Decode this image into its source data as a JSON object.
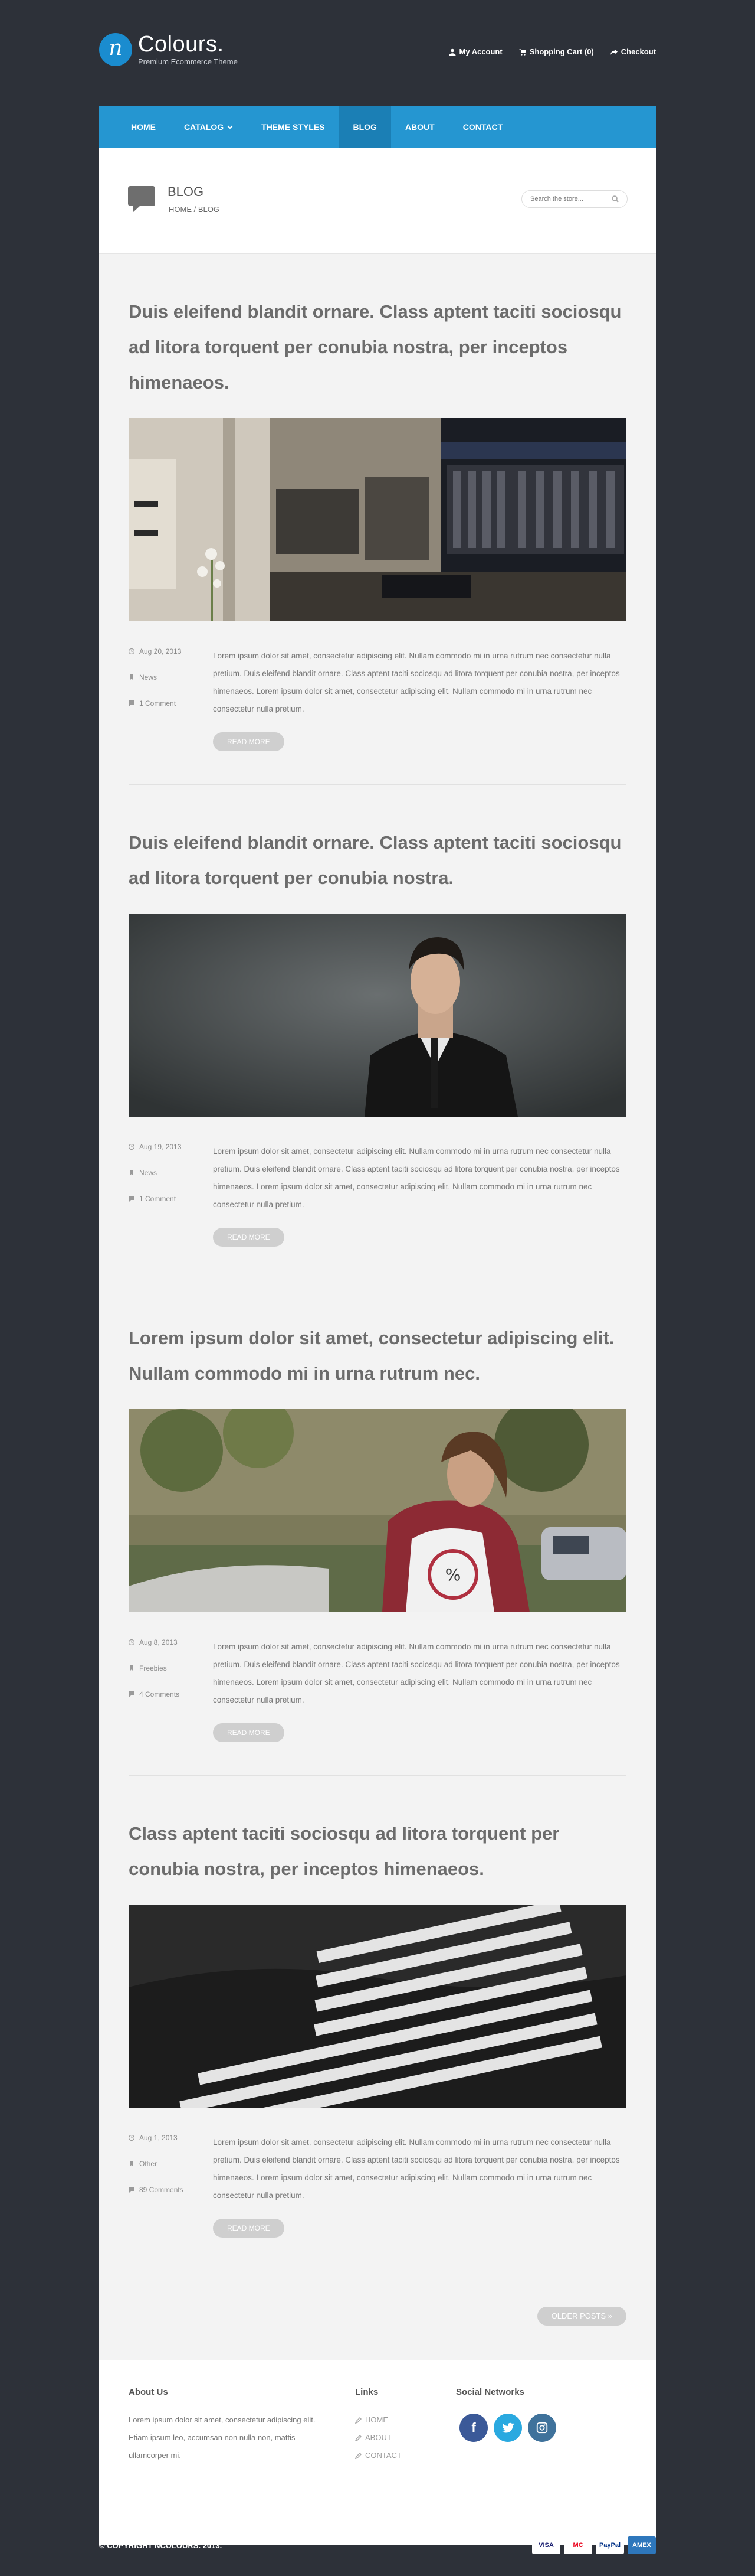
{
  "brand": {
    "logo_letter": "n",
    "name": "Colours.",
    "tagline": "Premium Ecommerce Theme",
    "accent_color": "#2596d1"
  },
  "account_links": [
    {
      "label": "My Account",
      "icon": "user-icon"
    },
    {
      "label": "Shopping Cart (0)",
      "icon": "cart-icon"
    },
    {
      "label": "Checkout",
      "icon": "share-icon"
    }
  ],
  "nav": [
    {
      "label": "HOME",
      "active": false
    },
    {
      "label": "CATALOG",
      "active": false,
      "dropdown": true
    },
    {
      "label": "THEME STYLES",
      "active": false
    },
    {
      "label": "BLOG",
      "active": true
    },
    {
      "label": "ABOUT",
      "active": false
    },
    {
      "label": "CONTACT",
      "active": false
    }
  ],
  "page": {
    "title": "BLOG",
    "breadcrumb": "HOME / BLOG",
    "search_placeholder": "Search the store..."
  },
  "posts": [
    {
      "title": "Duis eleifend blandit ornare. Class aptent taciti sociosqu ad litora torquent per conubia nostra, per inceptos himenaeos.",
      "image": "clothing-store-interior",
      "date": "Aug 20, 2013",
      "category": "News",
      "comments": "1 Comment",
      "text": "Lorem ipsum dolor sit amet, consectetur adipiscing elit. Nullam commodo mi in urna rutrum nec consectetur nulla pretium. Duis eleifend blandit ornare. Class aptent taciti sociosqu ad litora torquent per conubia nostra, per inceptos himenaeos. Lorem ipsum dolor sit amet, consectetur adipiscing elit. Nullam commodo mi in urna rutrum nec consectetur nulla pretium.",
      "read_more": "READ MORE"
    },
    {
      "title": "Duis eleifend blandit ornare. Class aptent taciti sociosqu ad litora torquent per conubia nostra.",
      "image": "man-in-suit",
      "date": "Aug 19, 2013",
      "category": "News",
      "comments": "1 Comment",
      "text": "Lorem ipsum dolor sit amet, consectetur adipiscing elit. Nullam commodo mi in urna rutrum nec consectetur nulla pretium. Duis eleifend blandit ornare. Class aptent taciti sociosqu ad litora torquent per conubia nostra, per inceptos himenaeos. Lorem ipsum dolor sit amet, consectetur adipiscing elit. Nullam commodo mi in urna rutrum nec consectetur nulla pretium.",
      "read_more": "READ MORE"
    },
    {
      "title": "Lorem ipsum dolor sit amet, consectetur adipiscing elit. Nullam commodo mi in urna rutrum nec.",
      "image": "woman-in-flannel-shirt",
      "date": "Aug 8, 2013",
      "category": "Freebies",
      "comments": "4 Comments",
      "text": "Lorem ipsum dolor sit amet, consectetur adipiscing elit. Nullam commodo mi in urna rutrum nec consectetur nulla pretium. Duis eleifend blandit ornare. Class aptent taciti sociosqu ad litora torquent per conubia nostra, per inceptos himenaeos. Lorem ipsum dolor sit amet, consectetur adipiscing elit. Nullam commodo mi in urna rutrum nec consectetur nulla pretium.",
      "read_more": "READ MORE"
    },
    {
      "title": "Class aptent taciti sociosqu ad litora torquent per conubia nostra, per inceptos himenaeos.",
      "image": "striped-fabric",
      "date": "Aug 1, 2013",
      "category": "Other",
      "comments": "89 Comments",
      "text": "Lorem ipsum dolor sit amet, consectetur adipiscing elit. Nullam commodo mi in urna rutrum nec consectetur nulla pretium. Duis eleifend blandit ornare. Class aptent taciti sociosqu ad litora torquent per conubia nostra, per inceptos himenaeos. Lorem ipsum dolor sit amet, consectetur adipiscing elit. Nullam commodo mi in urna rutrum nec consectetur nulla pretium.",
      "read_more": "READ MORE"
    }
  ],
  "pager": {
    "older_label": "OLDER POSTS »"
  },
  "footer": {
    "about_title": "About Us",
    "about_text": "Lorem ipsum dolor sit amet, consectetur adipiscing elit. Etiam ipsum leo, accumsan non nulla non, mattis ullamcorper mi.",
    "links_title": "Links",
    "links": [
      "HOME",
      "ABOUT",
      "CONTACT"
    ],
    "social_title": "Social Networks",
    "social": [
      {
        "name": "facebook-icon",
        "glyph": "f",
        "color": "#3b5998"
      },
      {
        "name": "twitter-icon",
        "glyph": "t",
        "color": "#2aa9e0"
      },
      {
        "name": "instagram-icon",
        "glyph": "◙",
        "color": "#3f729b"
      }
    ]
  },
  "copyright": "© COPYRIGHT NCOLOURS. 2013.",
  "payments": [
    "VISA",
    "MC",
    "PayPal",
    "AMEX"
  ]
}
